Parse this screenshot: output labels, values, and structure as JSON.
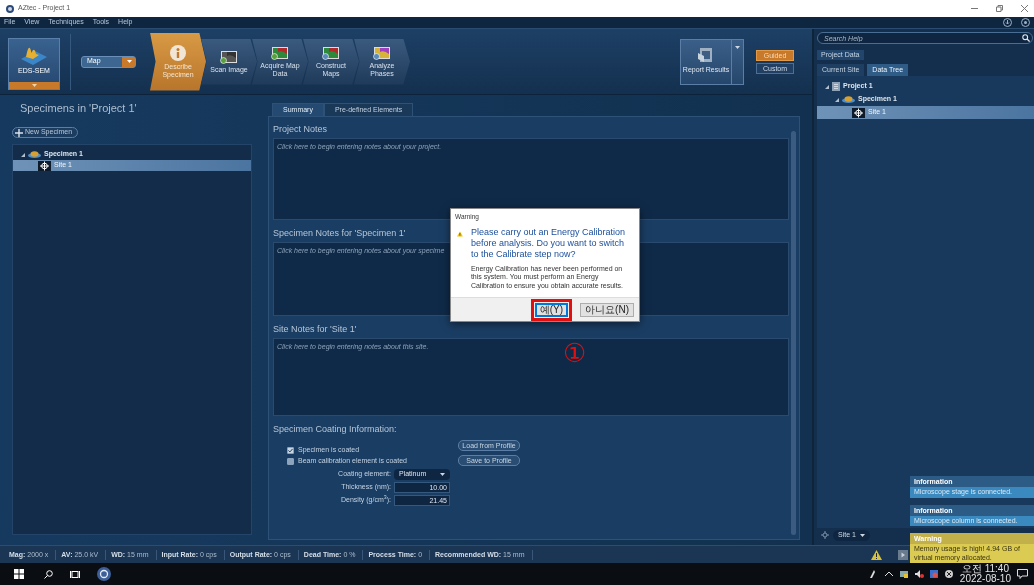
{
  "window": {
    "title": "AZtec - Project 1"
  },
  "menu": [
    "File",
    "View",
    "Techniques",
    "Tools",
    "Help"
  ],
  "toolbar": {
    "technique": "EDS-SEM",
    "mode": "Map",
    "steps": [
      {
        "label": "Describe Specimen",
        "selected": true
      },
      {
        "label": "Scan Image",
        "selected": false
      },
      {
        "label": "Acquire Map Data",
        "selected": false
      },
      {
        "label": "Construct Maps",
        "selected": false
      },
      {
        "label": "Analyze Phases",
        "selected": false
      }
    ],
    "report": "Report Results",
    "modes": [
      {
        "label": "Guided",
        "selected": true
      },
      {
        "label": "Custom",
        "selected": false
      }
    ]
  },
  "left_panel": {
    "title": "Specimens in 'Project 1'",
    "new_button": "New Specimen",
    "tree": [
      {
        "label": "Specimen 1",
        "kind": "specimen",
        "expanded": true,
        "selected": false,
        "children": [
          {
            "label": "Site 1",
            "kind": "site",
            "selected": true
          }
        ]
      }
    ]
  },
  "center": {
    "tabs": [
      {
        "label": "Summary",
        "selected": true
      },
      {
        "label": "Pre-defined Elements",
        "selected": false
      }
    ],
    "notes": [
      {
        "heading": "Project Notes",
        "placeholder": "Click here to begin entering notes about your project."
      },
      {
        "heading": "Specimen Notes for 'Specimen 1'",
        "placeholder": "Click here to begin entering notes about your specime"
      },
      {
        "heading": "Site Notes for 'Site 1'",
        "placeholder": "Click here to begin entering notes about this site."
      }
    ],
    "coating": {
      "heading": "Specimen Coating Information:",
      "checkboxes": [
        {
          "label": "Specimen is coated",
          "checked": true
        },
        {
          "label": "Beam calibration element is coated",
          "checked": false
        }
      ],
      "element_label": "Coating element:",
      "element": "Platinum",
      "thickness_label": "Thickness (nm):",
      "thickness": "10.00",
      "density_label": "Density (g/cm$^{3}$):",
      "density": "21.45",
      "buttons": [
        "Load from Profile",
        "Save to Profile"
      ]
    }
  },
  "right_panel": {
    "search": {
      "placeholder": "Search Help"
    },
    "header": "Project Data",
    "tabs": [
      {
        "label": "Current Site",
        "selected": false
      },
      {
        "label": "Data Tree",
        "selected": true
      }
    ],
    "tree": [
      {
        "label": "Project 1",
        "kind": "project",
        "expanded": true,
        "selected": false,
        "children": [
          {
            "label": "Specimen 1",
            "kind": "specimen",
            "expanded": true,
            "selected": false,
            "children": [
              {
                "label": "Site 1",
                "kind": "site",
                "selected": true
              }
            ]
          }
        ]
      }
    ],
    "site_selector": "Site 1"
  },
  "dialog": {
    "title": "Warning",
    "message": "Please carry out an Energy Calibration before analysis. Do you want to switch to the Calibrate step now?",
    "detail": "Energy Calibration has never been performed on this system. You must perform an Energy Calibration to ensure you obtain accurate results.",
    "buttons": [
      {
        "label": "예(Y)",
        "focused": true,
        "annotated": true
      },
      {
        "label": "아니요(N)",
        "focused": false,
        "annotated": false
      }
    ],
    "annotation": "①"
  },
  "notifications": [
    {
      "kind": "info",
      "title": "Information",
      "message": "Microscope stage is connected."
    },
    {
      "kind": "info",
      "title": "Information",
      "message": "Microscope column is connected."
    },
    {
      "kind": "warning",
      "title": "Warning",
      "message": "Memory usage is high! 4.94 GB of virtual memory allocated."
    }
  ],
  "status_bar": [
    "**Mag:** 2000 x",
    "**AV:** 25.0 kV",
    "**WD:** 15 mm",
    "**Input Rate:** 0 cps",
    "**Output Rate:** 0 cps",
    "**Dead Time:** 0 %",
    "**Process Time:** 0",
    "**Recommended WD:** 15 mm"
  ],
  "taskbar": {
    "time": "오전 11:40",
    "date": "2022-08-10"
  }
}
